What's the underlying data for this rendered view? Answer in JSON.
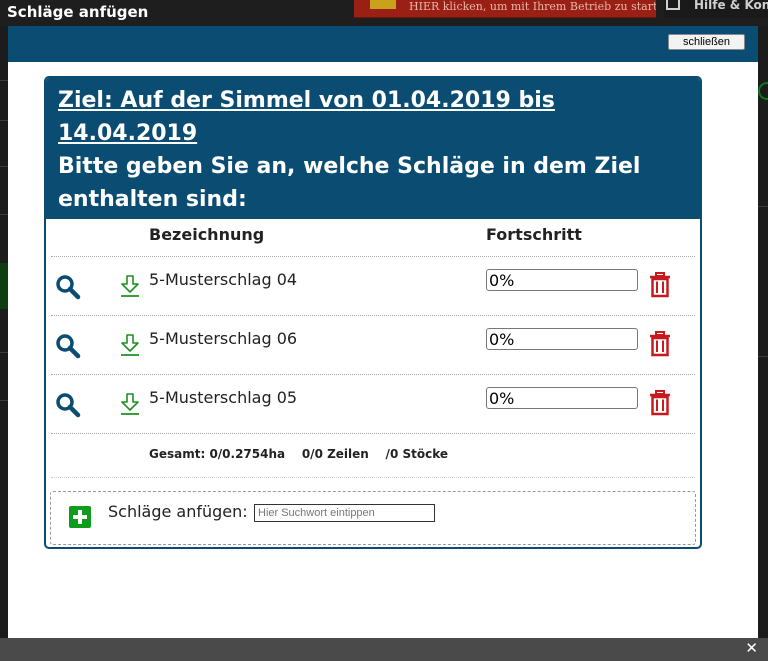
{
  "window": {
    "title": "Schläge anfügen",
    "banner_text": "HIER klicken, um mit Ihrem Betrieb zu starten.",
    "banner_right_text": "Hilfe & Kontakt",
    "bottom_close": "✕"
  },
  "modal": {
    "close_label": "schließen",
    "ziel_title": "Ziel: Auf der Simmel von 01.04.2019 bis 14.04.2019",
    "instruction": "Bitte geben Sie an, welche Schläge in dem Ziel enthalten sind:"
  },
  "table": {
    "headers": {
      "name": "Bezeichnung",
      "progress": "Fortschritt"
    },
    "rows": [
      {
        "name": "5-Musterschlag 04",
        "progress": "0%"
      },
      {
        "name": "5-Musterschlag 06",
        "progress": "0%"
      },
      {
        "name": "5-Musterschlag 05",
        "progress": "0%"
      }
    ],
    "summary": "Gesamt: 0/0.2754ha    0/0 Zeilen    /0 Stöcke"
  },
  "add": {
    "label": "Schläge anfügen:",
    "placeholder": "Hier Suchwort eintippen"
  },
  "colors": {
    "primary": "#0b4d72",
    "download_icon": "#1f8f1f",
    "delete_icon": "#c8191e",
    "add_icon": "#0f9b1c"
  },
  "icons": {
    "search": "search-icon",
    "download": "download-icon",
    "delete": "trash-icon",
    "add": "plus-icon"
  }
}
